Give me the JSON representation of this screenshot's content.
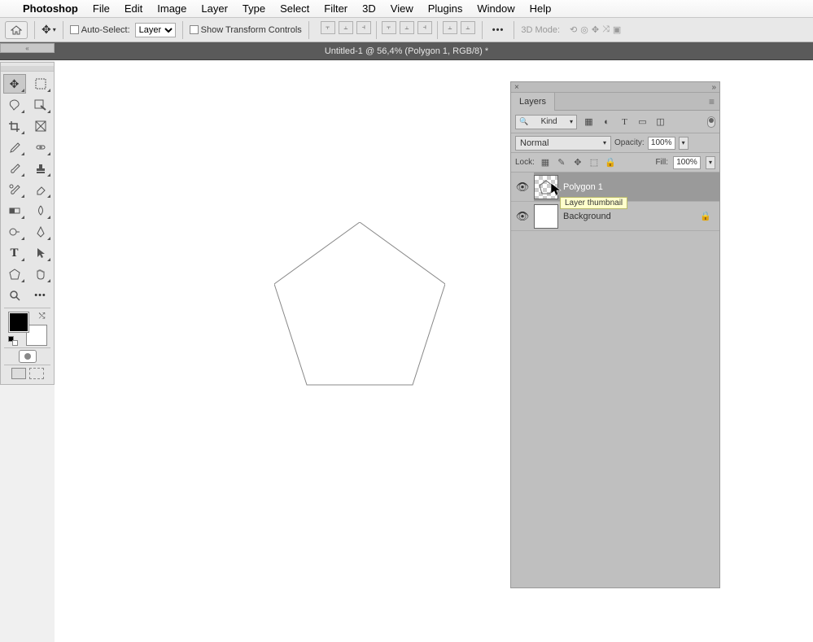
{
  "menubar": {
    "app": "Photoshop",
    "items": [
      "File",
      "Edit",
      "Image",
      "Layer",
      "Type",
      "Select",
      "Filter",
      "3D",
      "View",
      "Plugins",
      "Window",
      "Help"
    ]
  },
  "optbar": {
    "autoSelect": "Auto-Select:",
    "layerDropdown": "Layer",
    "showTransform": "Show Transform Controls",
    "threeDMode": "3D Mode:"
  },
  "tabbar": {
    "title": "Untitled-1 @ 56,4% (Polygon 1, RGB/8) *"
  },
  "tools": {
    "names": [
      "move",
      "marquee",
      "lasso",
      "wand",
      "crop",
      "frame",
      "eyedropper",
      "healing",
      "brush",
      "stamp",
      "history-brush",
      "eraser",
      "paint-bucket",
      "blur",
      "dodge",
      "pen",
      "type",
      "path-select",
      "shape",
      "hand",
      "zoom",
      "more-tools"
    ]
  },
  "layersPanel": {
    "title": "Layers",
    "kindLabel": "Kind",
    "blendMode": "Normal",
    "opacityLabel": "Opacity:",
    "opacityValue": "100%",
    "lockLabel": "Lock:",
    "fillLabel": "Fill:",
    "fillValue": "100%",
    "layers": [
      {
        "name": "Polygon 1",
        "selected": true,
        "thumbType": "checker",
        "locked": false
      },
      {
        "name": "Background",
        "selected": false,
        "thumbType": "white",
        "locked": true
      }
    ]
  },
  "tooltip": {
    "text": "Layer thumbnail"
  }
}
